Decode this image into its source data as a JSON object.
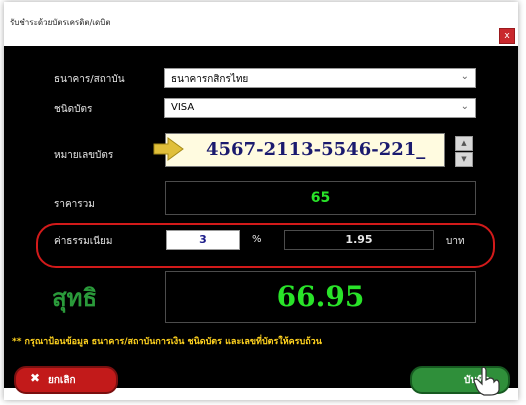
{
  "window": {
    "title": "รับชำระด้วยบัตรเครดิต/เดบิต",
    "close_label": "x"
  },
  "form": {
    "bank_label": "ธนาคาร/สถาบัน",
    "bank_value": "ธนาคารกสิกรไทย",
    "card_type_label": "ชนิดบัตร",
    "card_type_value": "VISA",
    "card_number_label": "หมายเลขบัตร",
    "card_number_value": "4567-2113-5546-221_",
    "total_label": "ราคารวม",
    "total_value": "65",
    "fee_label": "ค่าธรรมเนียม",
    "fee_percent": "3",
    "fee_percent_unit": "%",
    "fee_amount": "1.95",
    "fee_currency": "บาท",
    "net_label": "สุทธิ",
    "net_value": "66.95"
  },
  "note": "** กรุณาป้อนข้อมูล ธนาคาร/สถาบันการเงิน ชนิดบัตร และเลขที่บัตรให้ครบถ้วน",
  "buttons": {
    "cancel_label": "ยกเลิก",
    "save_label": "บันทึก"
  },
  "colors": {
    "accent_green": "#29e329",
    "fee_border": "#d21a1a",
    "note": "#ffd21f"
  }
}
